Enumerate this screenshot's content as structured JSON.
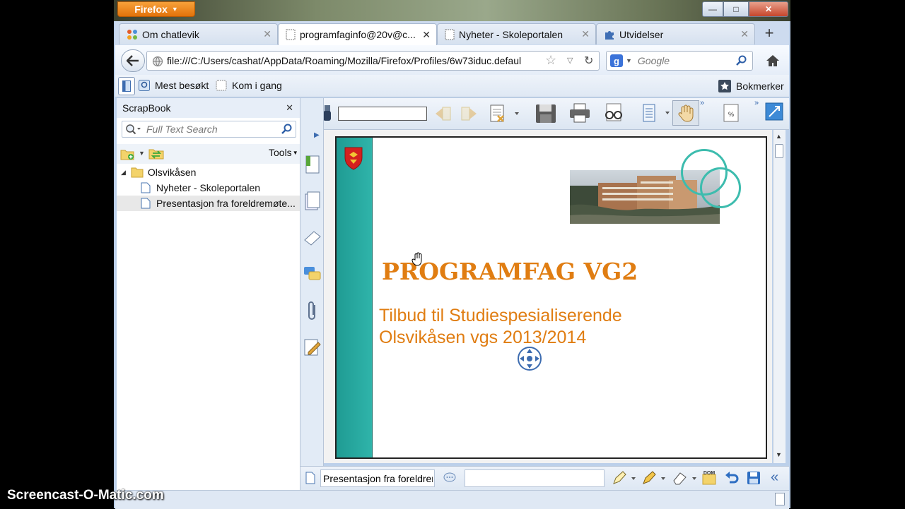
{
  "window": {
    "app_button": "Firefox",
    "controls": {
      "minimize": "—",
      "maximize": "□",
      "close": "✕"
    }
  },
  "tabs": [
    {
      "label": "Om chatlevik",
      "icon": "joomla-icon",
      "active": false
    },
    {
      "label": "programfaginfo@20v@c...",
      "icon": "blank-page-icon",
      "active": true
    },
    {
      "label": "Nyheter - Skoleportalen",
      "icon": "blank-page-icon",
      "active": false
    },
    {
      "label": "Utvidelser",
      "icon": "puzzle-icon",
      "active": false
    }
  ],
  "new_tab": "+",
  "navbar": {
    "url": "file:///C:/Users/cashat/AppData/Roaming/Mozilla/Firefox/Profiles/6w73iduc.defaul",
    "search_placeholder": "Google"
  },
  "bookmarks_bar": {
    "items": [
      "Mest besøkt",
      "Kom i gang"
    ],
    "bookmarks_label": "Bokmerker"
  },
  "sidebar": {
    "title": "ScrapBook",
    "search_placeholder": "Full Text Search",
    "tools_label": "Tools",
    "tree": [
      {
        "label": "Olsvikåsen",
        "type": "folder"
      },
      {
        "label": "Nyheter - Skoleportalen",
        "type": "page"
      },
      {
        "label": "Presentasjon fra foreldremøte...",
        "type": "page",
        "selected": true
      }
    ]
  },
  "pdf_toolbar": {
    "find_value": ""
  },
  "slide": {
    "title": "PROGRAMFAG VG2",
    "line1": "Tilbud til Studiespesialiserende",
    "line2": "Olsvikåsen vgs 2013/2014",
    "colors": {
      "title": "#e07d12",
      "sidebar": "#27a39a",
      "circles": "#3dbcae"
    }
  },
  "bottom_bar": {
    "title_value": "Presentasjon fra foreldren",
    "comment_value": ""
  },
  "watermark": "Screencast-O-Matic.com"
}
